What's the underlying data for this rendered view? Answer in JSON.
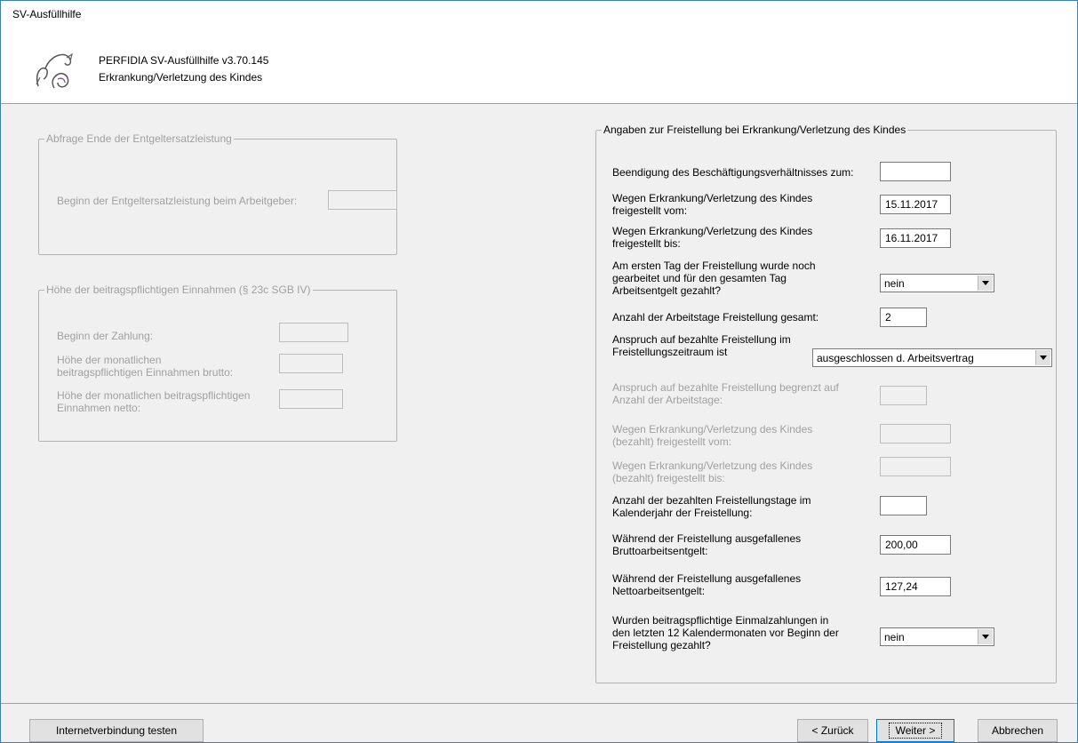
{
  "window": {
    "title": "SV-Ausfüllhilfe"
  },
  "header": {
    "app_version": "PERFIDIA SV-Ausfüllhilfe v3.70.145",
    "page_title": "Erkrankung/Verletzung des Kindes"
  },
  "group_entgeltersatz": {
    "legend": "Abfrage Ende der Entgeltersatzleistung",
    "beginn_label": "Beginn der Entgeltersatzleistung beim Arbeitgeber:",
    "beginn_value": ""
  },
  "group_einnahmen": {
    "legend": "Höhe der beitragspflichtigen Einnahmen (§ 23c SGB IV)",
    "beginn_zahlung_label": "Beginn der Zahlung:",
    "beginn_zahlung_value": "",
    "brutto_label_1": "Höhe der monatlichen",
    "brutto_label_2": "beitragspflichtigen Einnahmen brutto:",
    "brutto_value": "",
    "netto_label_1": "Höhe der monatlichen beitragspflichtigen",
    "netto_label_2": "Einnahmen netto:",
    "netto_value": ""
  },
  "group_freistellung": {
    "legend": "Angaben zur Freistellung bei Erkrankung/Verletzung des Kindes",
    "beendigung_label": "Beendigung des Beschäftigungsverhältnisses zum:",
    "beendigung_value": "",
    "vom_label_1": "Wegen Erkrankung/Verletzung des Kindes",
    "vom_label_2": "freigestellt vom:",
    "vom_value": "15.11.2017",
    "bis_label_1": "Wegen Erkrankung/Verletzung des Kindes",
    "bis_label_2": "freigestellt bis:",
    "bis_value": "16.11.2017",
    "erster_tag_label_1": "Am ersten Tag der Freistellung wurde noch",
    "erster_tag_label_2": "gearbeitet und für den gesamten Tag",
    "erster_tag_label_3": "Arbeitsentgelt gezahlt?",
    "erster_tag_value": "nein",
    "anzahl_tage_label": "Anzahl der Arbeitstage Freistellung gesamt:",
    "anzahl_tage_value": "2",
    "anspruch_label_1": "Anspruch auf bezahlte Freistellung im",
    "anspruch_label_2": "Freistellungszeitraum ist",
    "anspruch_value": "ausgeschlossen d. Arbeitsvertrag",
    "begrenzt_label_1": "Anspruch auf bezahlte Freistellung begrenzt auf",
    "begrenzt_label_2": "Anzahl der Arbeitstage:",
    "begrenzt_value": "",
    "bez_vom_label_1": "Wegen Erkrankung/Verletzung des Kindes",
    "bez_vom_label_2": "(bezahlt) freigestellt vom:",
    "bez_vom_value": "",
    "bez_bis_label_1": "Wegen Erkrankung/Verletzung des Kindes",
    "bez_bis_label_2": "(bezahlt) freigestellt bis:",
    "bez_bis_value": "",
    "bez_tage_label_1": "Anzahl der bezahlten Freistellungstage im",
    "bez_tage_label_2": "Kalenderjahr der Freistellung:",
    "bez_tage_value": "",
    "brutto_label_1": "Während der Freistellung ausgefallenes",
    "brutto_label_2": "Bruttoarbeitsentgelt:",
    "brutto_value": "200,00",
    "netto_label_1": "Während der Freistellung ausgefallenes",
    "netto_label_2": "Nettoarbeitsentgelt:",
    "netto_value": "127,24",
    "einmal_label_1": "Wurden beitragspflichtige Einmalzahlungen in",
    "einmal_label_2": "den letzten 12 Kalendermonaten vor Beginn der",
    "einmal_label_3": "Freistellung gezahlt?",
    "einmal_value": "nein"
  },
  "footer": {
    "internet_test": "Internetverbindung testen",
    "back": "< Zurück",
    "next": "Weiter >",
    "cancel": "Abbrechen"
  }
}
